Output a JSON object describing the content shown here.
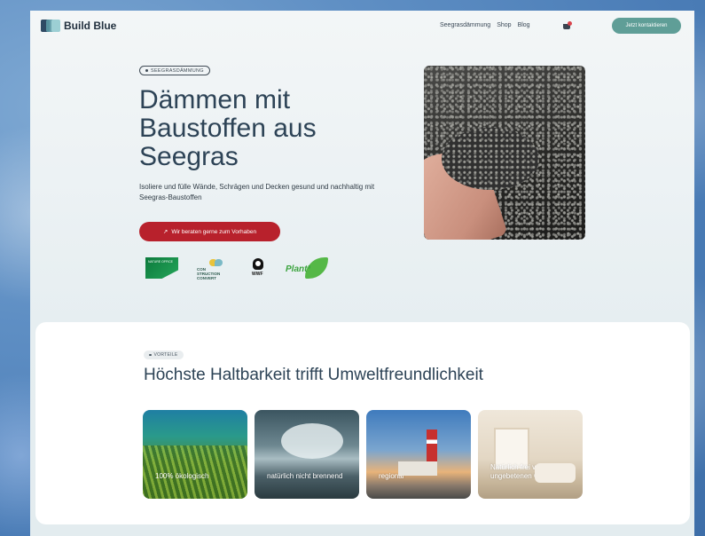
{
  "header": {
    "logo_text": "Build Blue",
    "nav": [
      "Seegrasdämmung",
      "Shop",
      "Blog"
    ],
    "cta": "Jetzt kontaktieren"
  },
  "hero": {
    "badge": "SEEGRASDÄMMUNG",
    "title": "Dämmen mit Baustoffen aus Seegras",
    "subtitle": "Isoliere und fülle Wände, Schrägen und Decken gesund und nachhaltig mit Seegras-Baustoffen",
    "cta": "Wir beraten gerne zum Vorhaben",
    "cta_icon": "arrow-up-right-icon"
  },
  "partners": {
    "logo1_text": "NATURE OFFICE",
    "logo2_text": "CON STRUCTION CONVERT",
    "logo3_text": "WWF",
    "logo4_text": "Plant³"
  },
  "benefits": {
    "badge": "VORTEILE",
    "title": "Höchste Haltbarkeit trifft Umweltfreundlichkeit",
    "cards": [
      {
        "label": "100% ökologisch"
      },
      {
        "label": "natürlich nicht brennend"
      },
      {
        "label": "regional"
      },
      {
        "label": "Natürlich frei von ungebetenen Gästen"
      }
    ]
  },
  "colors": {
    "accent_red": "#b8212c",
    "accent_teal": "#5f9e97",
    "heading": "#2d4356"
  }
}
